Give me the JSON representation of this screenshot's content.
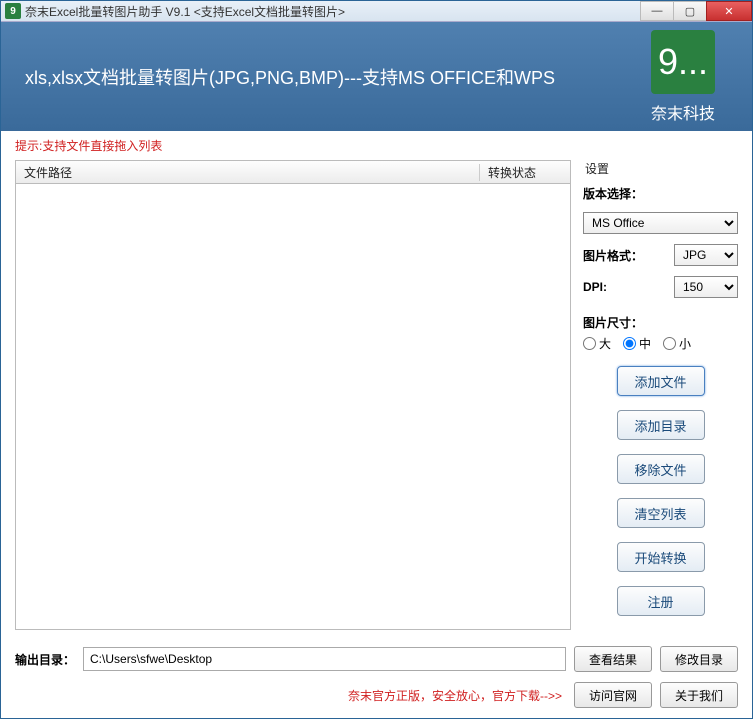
{
  "titlebar": {
    "icon_text": "9",
    "title": "奈末Excel批量转图片助手 V9.1 <支持Excel文档批量转图片>"
  },
  "banner": {
    "headline": "xls,xlsx文档批量转图片(JPG,PNG,BMP)---支持MS OFFICE和WPS",
    "logo_glyph": "9...",
    "company": "奈末科技"
  },
  "hint": "提示:支持文件直接拖入列表",
  "table": {
    "col_path": "文件路径",
    "col_status": "转换状态"
  },
  "settings": {
    "title": "设置",
    "version_label": "版本选择：",
    "version_value": "MS Office",
    "format_label": "图片格式：",
    "format_value": "JPG",
    "dpi_label": "DPI:",
    "dpi_value": "150",
    "size_label": "图片尺寸：",
    "size_options": {
      "large": "大",
      "medium": "中",
      "small": "小"
    },
    "size_selected": "medium"
  },
  "buttons": {
    "add_file": "添加文件",
    "add_dir": "添加目录",
    "remove_file": "移除文件",
    "clear_list": "清空列表",
    "start": "开始转换",
    "register": "注册"
  },
  "output": {
    "label": "输出目录：",
    "path": "C:\\Users\\sfwe\\Desktop",
    "view_result": "查看结果",
    "change_dir": "修改目录"
  },
  "footer": {
    "text": "奈末官方正版，安全放心，官方下载-->>",
    "visit_site": "访问官网",
    "about": "关于我们"
  }
}
